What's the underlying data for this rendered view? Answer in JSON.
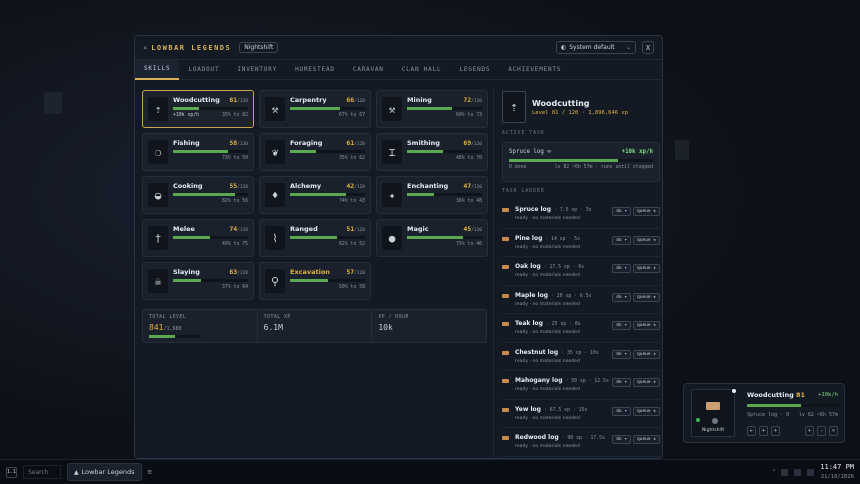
{
  "window": {
    "close_glyph": "×",
    "title": "LOWBAR LEGENDS",
    "badge": "Nightshift",
    "theme_select": "System default",
    "close_label": "X"
  },
  "tabs": [
    {
      "label": "SKILLS",
      "active": true
    },
    {
      "label": "LOADOUT"
    },
    {
      "label": "INVENTORY"
    },
    {
      "label": "HOMESTEAD"
    },
    {
      "label": "CARAVAN"
    },
    {
      "label": "CLAN HALL"
    },
    {
      "label": "LEGENDS"
    },
    {
      "label": "ACHIEVEMENTS"
    }
  ],
  "skills": [
    {
      "name": "Woodcutting",
      "level": "81",
      "max": "/120",
      "progress": 0.35,
      "rate": "+10k xp/h",
      "next": "35% to 82",
      "icon": "⇡",
      "selected": true
    },
    {
      "name": "Carpentry",
      "level": "66",
      "max": "/120",
      "progress": 0.67,
      "rate": "",
      "next": "67% to 67",
      "icon": "⚒"
    },
    {
      "name": "Mining",
      "level": "72",
      "max": "/120",
      "progress": 0.6,
      "rate": "",
      "next": "60% to 73",
      "icon": "⚒"
    },
    {
      "name": "Fishing",
      "level": "58",
      "max": "/120",
      "progress": 0.73,
      "rate": "",
      "next": "73% to 59",
      "icon": "❍"
    },
    {
      "name": "Foraging",
      "level": "61",
      "max": "/120",
      "progress": 0.35,
      "rate": "",
      "next": "35% to 62",
      "icon": "❦"
    },
    {
      "name": "Smithing",
      "level": "69",
      "max": "/120",
      "progress": 0.48,
      "rate": "",
      "next": "48% to 70",
      "icon": "⌶"
    },
    {
      "name": "Cooking",
      "level": "55",
      "max": "/120",
      "progress": 0.82,
      "rate": "",
      "next": "82% to 56",
      "icon": "◒"
    },
    {
      "name": "Alchemy",
      "level": "42",
      "max": "/120",
      "progress": 0.74,
      "rate": "",
      "next": "74% to 43",
      "icon": "♦"
    },
    {
      "name": "Enchanting",
      "level": "47",
      "max": "/120",
      "progress": 0.36,
      "rate": "",
      "next": "36% to 48",
      "icon": "✦"
    },
    {
      "name": "Melee",
      "level": "74",
      "max": "/120",
      "progress": 0.49,
      "rate": "",
      "next": "49% to 75",
      "icon": "†"
    },
    {
      "name": "Ranged",
      "level": "51",
      "max": "/120",
      "progress": 0.62,
      "rate": "",
      "next": "62% to 52",
      "icon": "⌇"
    },
    {
      "name": "Magic",
      "level": "45",
      "max": "/120",
      "progress": 0.75,
      "rate": "",
      "next": "75% to 46",
      "icon": "●"
    },
    {
      "name": "Slaying",
      "level": "63",
      "max": "/120",
      "progress": 0.37,
      "rate": "",
      "next": "37% to 64",
      "icon": "☠"
    },
    {
      "name": "Excavation",
      "level": "57",
      "max": "/120",
      "progress": 0.5,
      "rate": "",
      "next": "50% to 58",
      "icon": "⚲",
      "gold_name": true
    }
  ],
  "totals": {
    "level_label": "TOTAL LEVEL",
    "level": "841",
    "level_max": "/1,680",
    "level_progress": 0.5,
    "xp_label": "TOTAL XP",
    "xp": "6.1M",
    "rate_label": "XP / HOUR",
    "rate": "10k"
  },
  "selected": {
    "icon": "⇡",
    "name": "Woodcutting",
    "sub": "Level 81 / 120 · 1,896,646 xp"
  },
  "active_task": {
    "section": "ACTIVE TASK",
    "name": "Spruce log ∞",
    "rate": "+10k xp/h",
    "progress": 0.76,
    "done": "0 done",
    "eta": "lv 82 ~6h 57m · runs until stopped"
  },
  "ladder": {
    "section": "TASK LADDER",
    "items": [
      {
        "name": "Spruce log",
        "detail": "· 7.5 xp · 3s",
        "sub": "ready · no materials needed"
      },
      {
        "name": "Pine log",
        "detail": "· 14 xp · 5s",
        "sub": "ready · no materials needed"
      },
      {
        "name": "Oak log",
        "detail": "· 17.5 xp · 6s",
        "sub": "ready · no materials needed"
      },
      {
        "name": "Maple log",
        "detail": "· 20 xp · 6.5s",
        "sub": "ready · no materials needed"
      },
      {
        "name": "Teak log",
        "detail": "· 25 xp · 8s",
        "sub": "ready · no materials needed"
      },
      {
        "name": "Chestnut log",
        "detail": "· 35 xp · 10s",
        "sub": "ready · no materials needed"
      },
      {
        "name": "Mahogany log",
        "detail": "· 50 xp · 12.5s",
        "sub": "ready · no materials needed"
      },
      {
        "name": "Yew log",
        "detail": "· 67.5 xp · 15s",
        "sub": "ready · no materials needed"
      },
      {
        "name": "Redwood log",
        "detail": "· 90 xp · 17.5s",
        "sub": "ready · no materials needed"
      }
    ],
    "do_label": "do ▾",
    "queue_label": "queue ★"
  },
  "widget": {
    "label": "Nightshift",
    "title": "Woodcutting",
    "level": "81",
    "rate": "+10k/h",
    "progress": 0.58,
    "sub": "Spruce log · 0",
    "sub2": "lv 82 ~6h 57m",
    "btns_left": [
      "⇤",
      "+",
      "+"
    ],
    "btns_right": [
      "+",
      "-",
      "×"
    ]
  },
  "taskbar": {
    "start": "1.1",
    "search": "Search",
    "app": "Lowbar Legends",
    "menu": "≡",
    "time": "11:47 PM",
    "date": "21/10/2026"
  },
  "colors": {
    "accent": "#d9b25a",
    "progress": "#5aa84f",
    "level": "#e3b341"
  }
}
